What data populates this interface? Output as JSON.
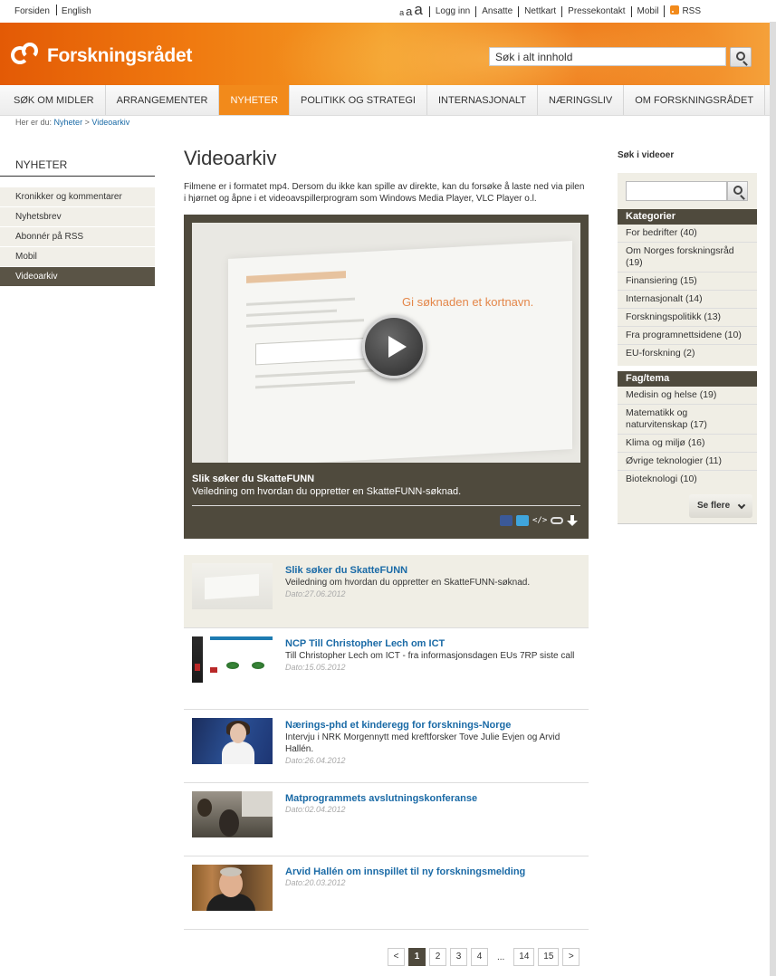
{
  "topbar": {
    "left_links": [
      "Forsiden",
      "English"
    ],
    "font_size_labels": [
      "a",
      "a",
      "a"
    ],
    "right_links": [
      "Logg inn",
      "Ansatte",
      "Nettkart",
      "Pressekontakt",
      "Mobil"
    ],
    "rss_label": "RSS"
  },
  "header": {
    "logo_text": "Forskningsrådet",
    "search_placeholder": "Søk i alt innhold"
  },
  "nav": {
    "items": [
      "SØK OM MIDLER",
      "ARRANGEMENTER",
      "NYHETER",
      "POLITIKK OG STRATEGI",
      "INTERNASJONALT",
      "NÆRINGSLIV",
      "OM FORSKNINGSRÅDET"
    ],
    "active_index": 2
  },
  "breadcrumb": {
    "prefix": "Her er du:",
    "items": [
      "Nyheter",
      "Videoarkiv"
    ],
    "separator": ">"
  },
  "sidebar": {
    "heading": "NYHETER",
    "items": [
      "Kronikker og kommentarer",
      "Nyhetsbrev",
      "Abonnér på RSS",
      "Mobil",
      "Videoarkiv"
    ],
    "active_index": 4
  },
  "main": {
    "title": "Videoarkiv",
    "intro": "Filmene er i formatet mp4. Dersom du ikke kan spille av direkte, kan du forsøke å laste ned via pilen i hjørnet og åpne i et videoavspillerprogram som Windows Media Player, VLC Player o.l.",
    "player": {
      "screen_headline": "Gi søknaden et kortnavn.",
      "title": "Slik søker du SkatteFUNN",
      "description": "Veiledning om hvordan du oppretter en SkatteFUNN-søknad.",
      "embed_label": "</>"
    },
    "videos": [
      {
        "title": "Slik søker du SkatteFUNN",
        "description": "Veiledning om hvordan du oppretter en SkatteFUNN-søknad.",
        "date": "Dato:27.06.2012"
      },
      {
        "title": "NCP Till Christopher Lech om ICT",
        "description": "Till Christopher Lech om ICT - fra informasjonsdagen EUs 7RP siste call",
        "date": "Dato:15.05.2012"
      },
      {
        "title": "Nærings-phd et kinderegg for forsknings-Norge",
        "description": "Intervju i NRK Morgennytt med kreftforsker Tove Julie Evjen og Arvid Hallén.",
        "date": "Dato:26.04.2012"
      },
      {
        "title": "Matprogrammets avslutningskonferanse",
        "description": "",
        "date": "Dato:02.04.2012"
      },
      {
        "title": "Arvid Hallén om innspillet til ny forskningsmelding",
        "description": "",
        "date": "Dato:20.03.2012"
      }
    ],
    "pagination": {
      "prev": "<",
      "pages": [
        "1",
        "2",
        "3",
        "4"
      ],
      "ellipsis": "...",
      "last_pages": [
        "14",
        "15"
      ],
      "next": ">",
      "current": "1"
    }
  },
  "right_sidebar": {
    "search_heading": "Søk i videoer",
    "categories_heading": "Kategorier",
    "categories": [
      "For bedrifter (40)",
      "Om Norges forskningsråd (19)",
      "Finansiering (15)",
      "Internasjonalt (14)",
      "Forskningspolitikk (13)",
      "Fra programnettsidene (10)",
      "EU-forskning (2)"
    ],
    "fag_heading": "Fag/tema",
    "fag": [
      "Medisin og helse (19)",
      "Matematikk og naturvitenskap (17)",
      "Klima og miljø (16)",
      "Øvrige teknologier (11)",
      "Bioteknologi (10)"
    ],
    "see_more": "Se flere"
  },
  "colors": {
    "brand_orange": "#f28a1b",
    "dark_olive": "#4f4a3d",
    "link_blue": "#1a6aa6"
  }
}
